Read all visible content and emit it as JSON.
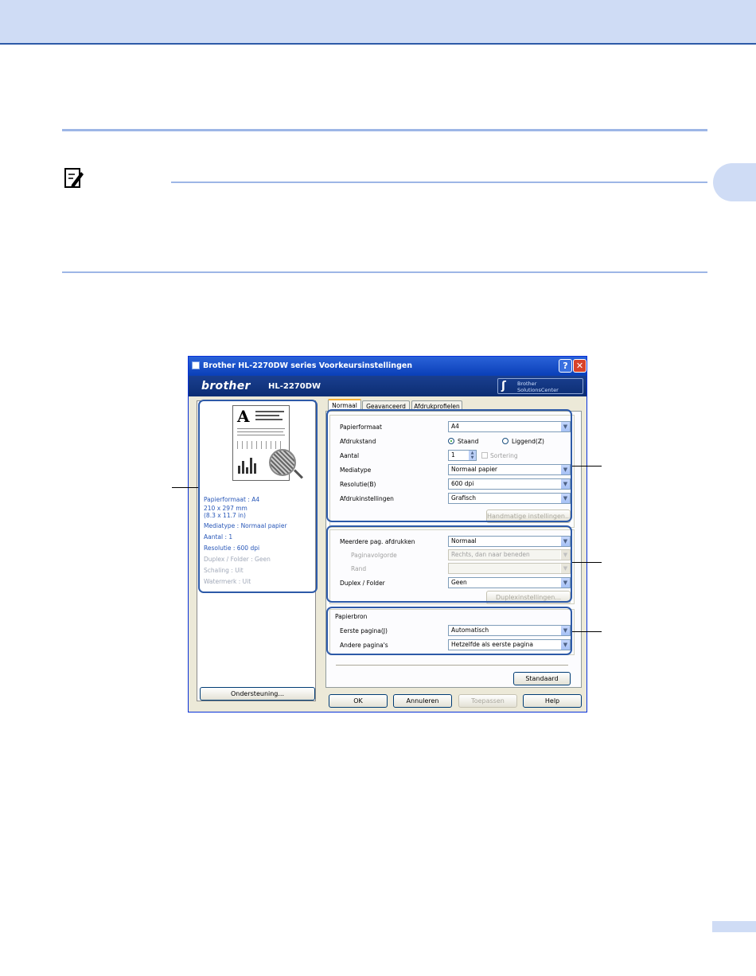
{
  "window": {
    "title": "Brother HL-2270DW series Voorkeursinstellingen",
    "help_glyph": "?",
    "close_glyph": "✕"
  },
  "banner": {
    "brand": "brother",
    "model": "HL-2270DW",
    "solutions_line1": "Brother",
    "solutions_line2": "SolutionsCenter"
  },
  "preview": {
    "info": [
      "Papierformaat : A4",
      "210 x 297 mm",
      "(8.3 x 11.7 in)",
      "Mediatype : Normaal papier",
      "Aantal : 1",
      "Resolutie : 600 dpi",
      "Duplex / Folder : Geen",
      "Schaling : Uit",
      "Watermerk : Uit"
    ],
    "support_button": "Ondersteuning..."
  },
  "tabs": [
    "Normaal",
    "Geavanceerd",
    "Afdrukprofielen"
  ],
  "group1": {
    "paper_size_label": "Papierformaat",
    "paper_size_value": "A4",
    "orientation_label": "Afdrukstand",
    "orientation_portrait": "Staand",
    "orientation_landscape": "Liggend(Z)",
    "copies_label": "Aantal",
    "copies_value": "1",
    "collate_label": "Sortering",
    "media_label": "Mediatype",
    "media_value": "Normaal papier",
    "resolution_label": "Resolutie(B)",
    "resolution_value": "600 dpi",
    "print_settings_label": "Afdrukinstellingen",
    "print_settings_value": "Grafisch",
    "manual_button": "Handmatige instellingen..."
  },
  "group2": {
    "multipage_label": "Meerdere pag. afdrukken",
    "multipage_value": "Normaal",
    "page_order_label": "Paginavolgorde",
    "page_order_value": "Rechts, dan naar beneden",
    "border_label": "Rand",
    "duplex_label": "Duplex / Folder",
    "duplex_value": "Geen",
    "duplex_button": "Duplexinstellingen..."
  },
  "group3": {
    "source_title": "Papierbron",
    "first_page_label": "Eerste pagina(J)",
    "first_page_value": "Automatisch",
    "other_pages_label": "Andere pagina's",
    "other_pages_value": "Hetzelfde als eerste pagina"
  },
  "buttons": {
    "default": "Standaard",
    "ok": "OK",
    "cancel": "Annuleren",
    "apply": "Toepassen",
    "help": "Help"
  },
  "colors": {
    "callout": "#2d5aa8",
    "header_band": "#cfdcf5",
    "titlebar": "#0a3fb8"
  }
}
